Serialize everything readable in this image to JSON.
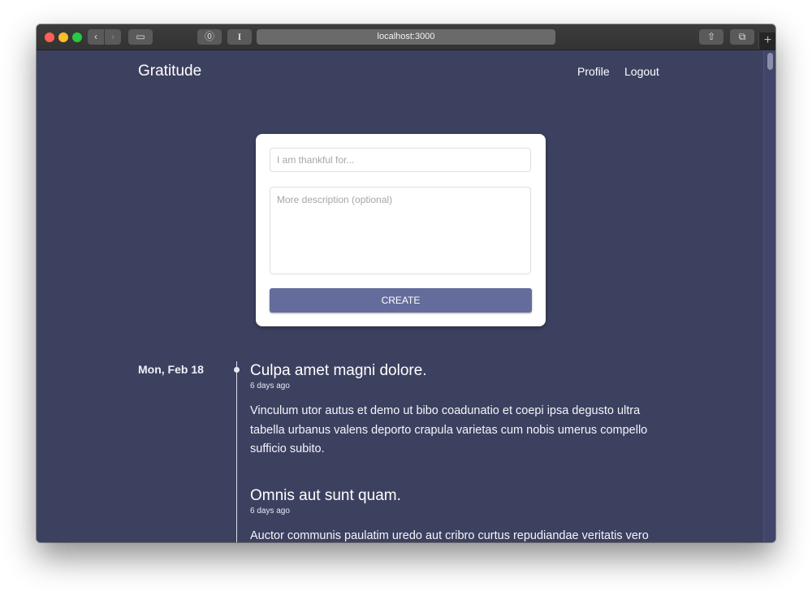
{
  "browser": {
    "url": "localhost:3000",
    "back_icon": "‹",
    "forward_icon": "›",
    "sidebar_icon": "▭",
    "password_icon": "⓪",
    "reader_icon": "I",
    "share_icon": "⇧",
    "tabs_icon": "⧉",
    "new_tab_icon": "+"
  },
  "header": {
    "brand": "Gratitude",
    "nav": [
      {
        "label": "Profile"
      },
      {
        "label": "Logout"
      }
    ]
  },
  "form": {
    "title_placeholder": "I am thankful for...",
    "title_value": "",
    "description_placeholder": "More description (optional)",
    "description_value": "",
    "submit_label": "CREATE"
  },
  "timeline": {
    "groups": [
      {
        "date": "Mon, Feb 18",
        "entries": [
          {
            "title": "Culpa amet magni dolore.",
            "time": "6 days ago",
            "body": "Vinculum utor autus et demo ut bibo coadunatio et coepi ipsa degusto ultra tabella urbanus valens deporto crapula varietas cum nobis umerus compello sufficio subito."
          },
          {
            "title": "Omnis aut sunt quam.",
            "time": "6 days ago",
            "body": "Auctor communis paulatim uredo aut cribro curtus repudiandae veritatis vero sodalitas atqui sint quia conscendo tracto nihil complectus dolorem certo"
          }
        ]
      }
    ]
  },
  "colors": {
    "background": "#3d4160",
    "button": "#646c9b",
    "card": "#ffffff"
  }
}
